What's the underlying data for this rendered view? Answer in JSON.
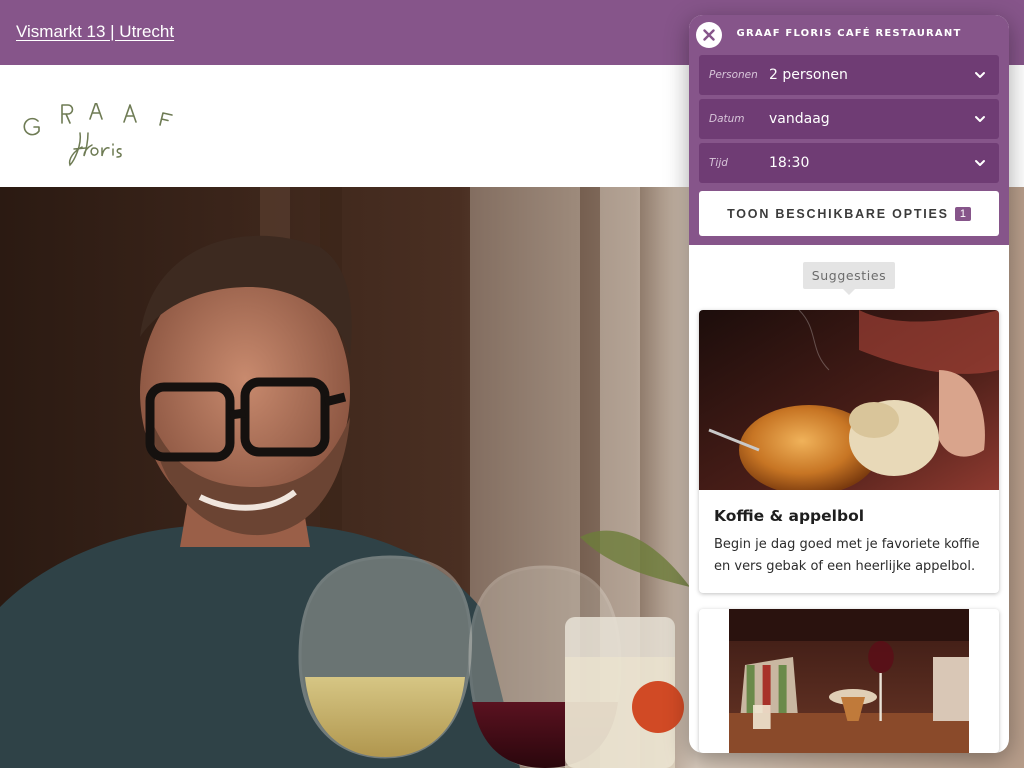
{
  "topbar": {
    "address": "Vismarkt 13 | Utrecht"
  },
  "logo": {
    "line1": "GRAAF",
    "line2": "Floris"
  },
  "hero": {
    "image": "photo_ref"
  },
  "widget": {
    "title": "GRAAF FLORIS CAFÉ RESTAURANT",
    "fields": [
      {
        "label": "Personen",
        "value": "2 personen"
      },
      {
        "label": "Datum",
        "value": "vandaag"
      },
      {
        "label": "Tijd",
        "value": "18:30"
      }
    ],
    "options_button": {
      "label": "TOON BESCHIKBARE OPTIES",
      "count": "1"
    },
    "suggestions_label": "Suggesties",
    "cards": [
      {
        "image": "photo_ref",
        "title": "Koffie & appelbol",
        "description": "Begin je dag goed met je favoriete koffie en vers gebak of een heerlijke appelbol."
      },
      {
        "image": "photo_ref",
        "title": "",
        "description": ""
      }
    ]
  },
  "icons": {
    "close": "close-icon",
    "dropdown": "chevron-down-icon"
  },
  "colors": {
    "brand_purple": "#86558a",
    "field_purple": "#6f3c74",
    "logo_green": "#6e7b54"
  }
}
